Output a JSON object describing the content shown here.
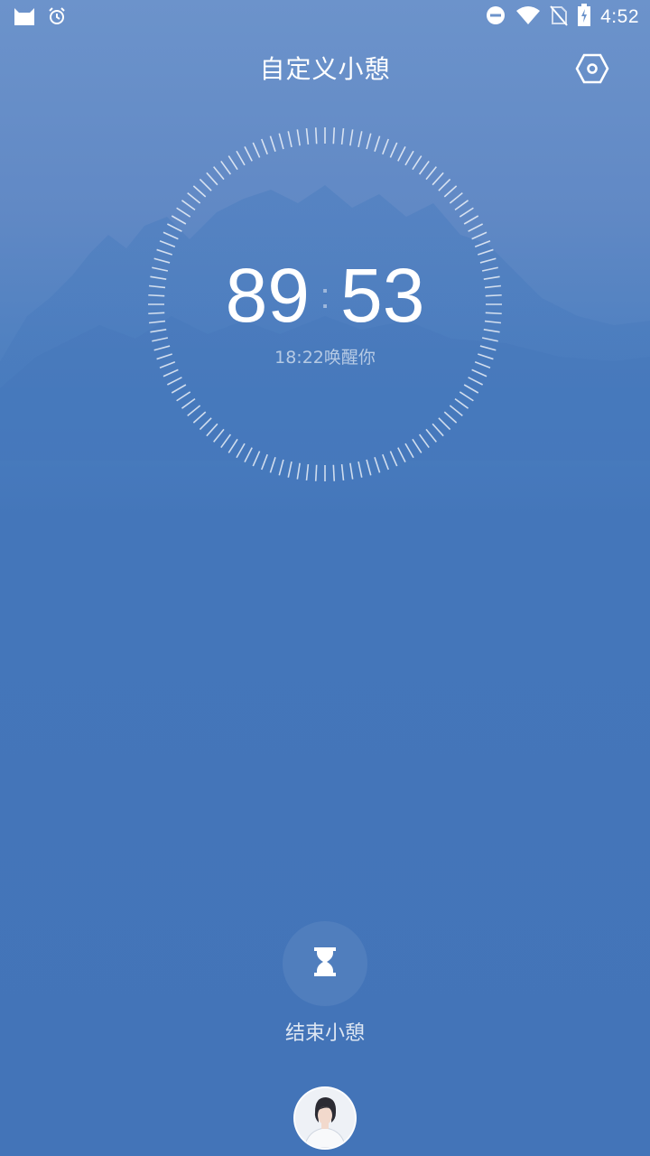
{
  "status_bar": {
    "time": "4:52",
    "icons": [
      "cat-app-icon",
      "alarm-icon",
      "do-not-disturb-icon",
      "wifi-icon",
      "no-sim-icon",
      "battery-charging-icon"
    ]
  },
  "header": {
    "title": "自定义小憩",
    "settings_icon": "hexagon-settings-icon"
  },
  "timer": {
    "minutes": "89",
    "separator": ":",
    "seconds": "53",
    "wake_text": "18:22唤醒你"
  },
  "end_break": {
    "icon": "hourglass-icon",
    "label": "结束小憩"
  },
  "avatar": {
    "icon": "user-avatar"
  },
  "colors": {
    "background_top": "#6c93cb",
    "background_bottom": "#4374b8",
    "text": "#ffffff"
  }
}
